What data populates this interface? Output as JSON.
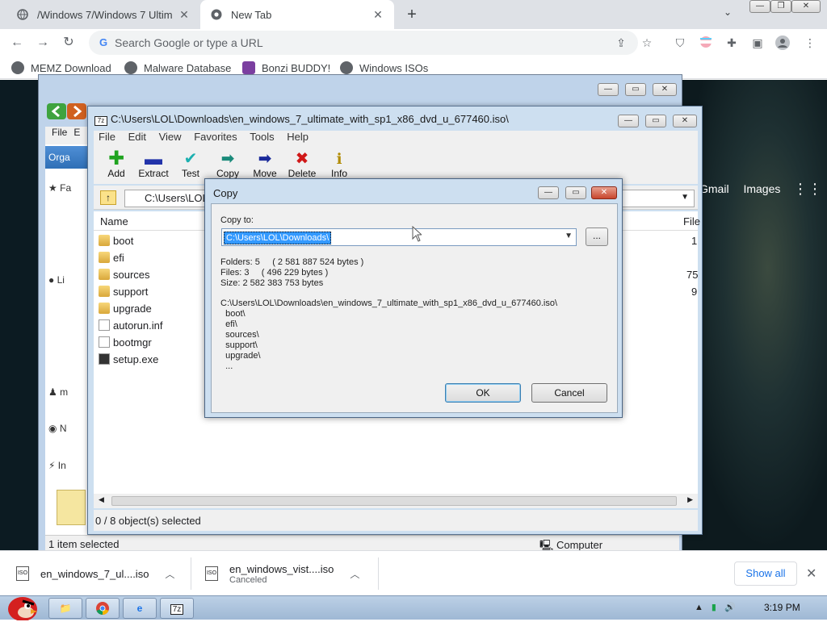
{
  "browser": {
    "tabs": [
      {
        "title": "/Windows 7/Windows 7 Ultim",
        "close": "✕"
      },
      {
        "title": "New Tab",
        "close": "✕"
      }
    ],
    "new_tab": "+",
    "omnibox_placeholder": "Search Google or type a URL",
    "bookmarks": [
      "MEMZ Download",
      "Malware Database",
      "Bonzi BUDDY!",
      "Windows ISOs"
    ],
    "newtab_links": {
      "gmail": "Gmail",
      "images": "Images"
    }
  },
  "explorer": {
    "menu": "File",
    "menu2": "E",
    "organize": "Orga",
    "sidebar": [
      "Fa",
      "Li",
      "m",
      "N",
      "In"
    ],
    "status": "1 item selected",
    "location": "Computer"
  },
  "sevenzip": {
    "title": "C:\\Users\\LOL\\Downloads\\en_windows_7_ultimate_with_sp1_x86_dvd_u_677460.iso\\",
    "menu": [
      "File",
      "Edit",
      "View",
      "Favorites",
      "Tools",
      "Help"
    ],
    "tools": [
      {
        "label": "Add",
        "icon": "plus-icon"
      },
      {
        "label": "Extract",
        "icon": "minus-icon"
      },
      {
        "label": "Test",
        "icon": "check-icon"
      },
      {
        "label": "Copy",
        "icon": "copy-arrow-icon"
      },
      {
        "label": "Move",
        "icon": "move-arrow-icon"
      },
      {
        "label": "Delete",
        "icon": "delete-x-icon"
      },
      {
        "label": "Info",
        "icon": "info-icon"
      }
    ],
    "address": "C:\\Users\\LOL\\",
    "columns": {
      "name": "Name",
      "size": "File"
    },
    "items": [
      {
        "name": "boot",
        "type": "folder",
        "size": "1"
      },
      {
        "name": "efi",
        "type": "folder",
        "size": ""
      },
      {
        "name": "sources",
        "type": "folder",
        "size": "75"
      },
      {
        "name": "support",
        "type": "folder",
        "size": "9"
      },
      {
        "name": "upgrade",
        "type": "folder",
        "size": ""
      },
      {
        "name": "autorun.inf",
        "type": "file",
        "size": ""
      },
      {
        "name": "bootmgr",
        "type": "file",
        "size": ""
      },
      {
        "name": "setup.exe",
        "type": "file",
        "size": ""
      }
    ],
    "status": "0 / 8 object(s) selected"
  },
  "dialog": {
    "title": "Copy",
    "copy_to_label": "Copy to:",
    "copy_to_value": "C:\\Users\\LOL\\Downloads\\",
    "browse_label": "...",
    "folders": "Folders: 5     ( 2 581 887 524 bytes )",
    "files": "Files: 3     ( 496 229 bytes )",
    "size": "Size: 2 582 383 753 bytes",
    "paths": [
      "C:\\Users\\LOL\\Downloads\\en_windows_7_ultimate_with_sp1_x86_dvd_u_677460.iso\\",
      "  boot\\",
      "  efi\\",
      "  sources\\",
      "  support\\",
      "  upgrade\\",
      "  ..."
    ],
    "ok": "OK",
    "cancel": "Cancel"
  },
  "downloads": [
    {
      "name": "en_windows_7_ul....iso",
      "status": ""
    },
    {
      "name": "en_windows_vist....iso",
      "status": "Canceled"
    }
  ],
  "show_all": "Show all",
  "taskbar": {
    "clock": "3:19 PM",
    "iso_badge": "iso"
  },
  "colors": {
    "chrome_bg": "#dee1e6",
    "accent_blue": "#1a73e8",
    "win7_frame": "#cddff0"
  }
}
